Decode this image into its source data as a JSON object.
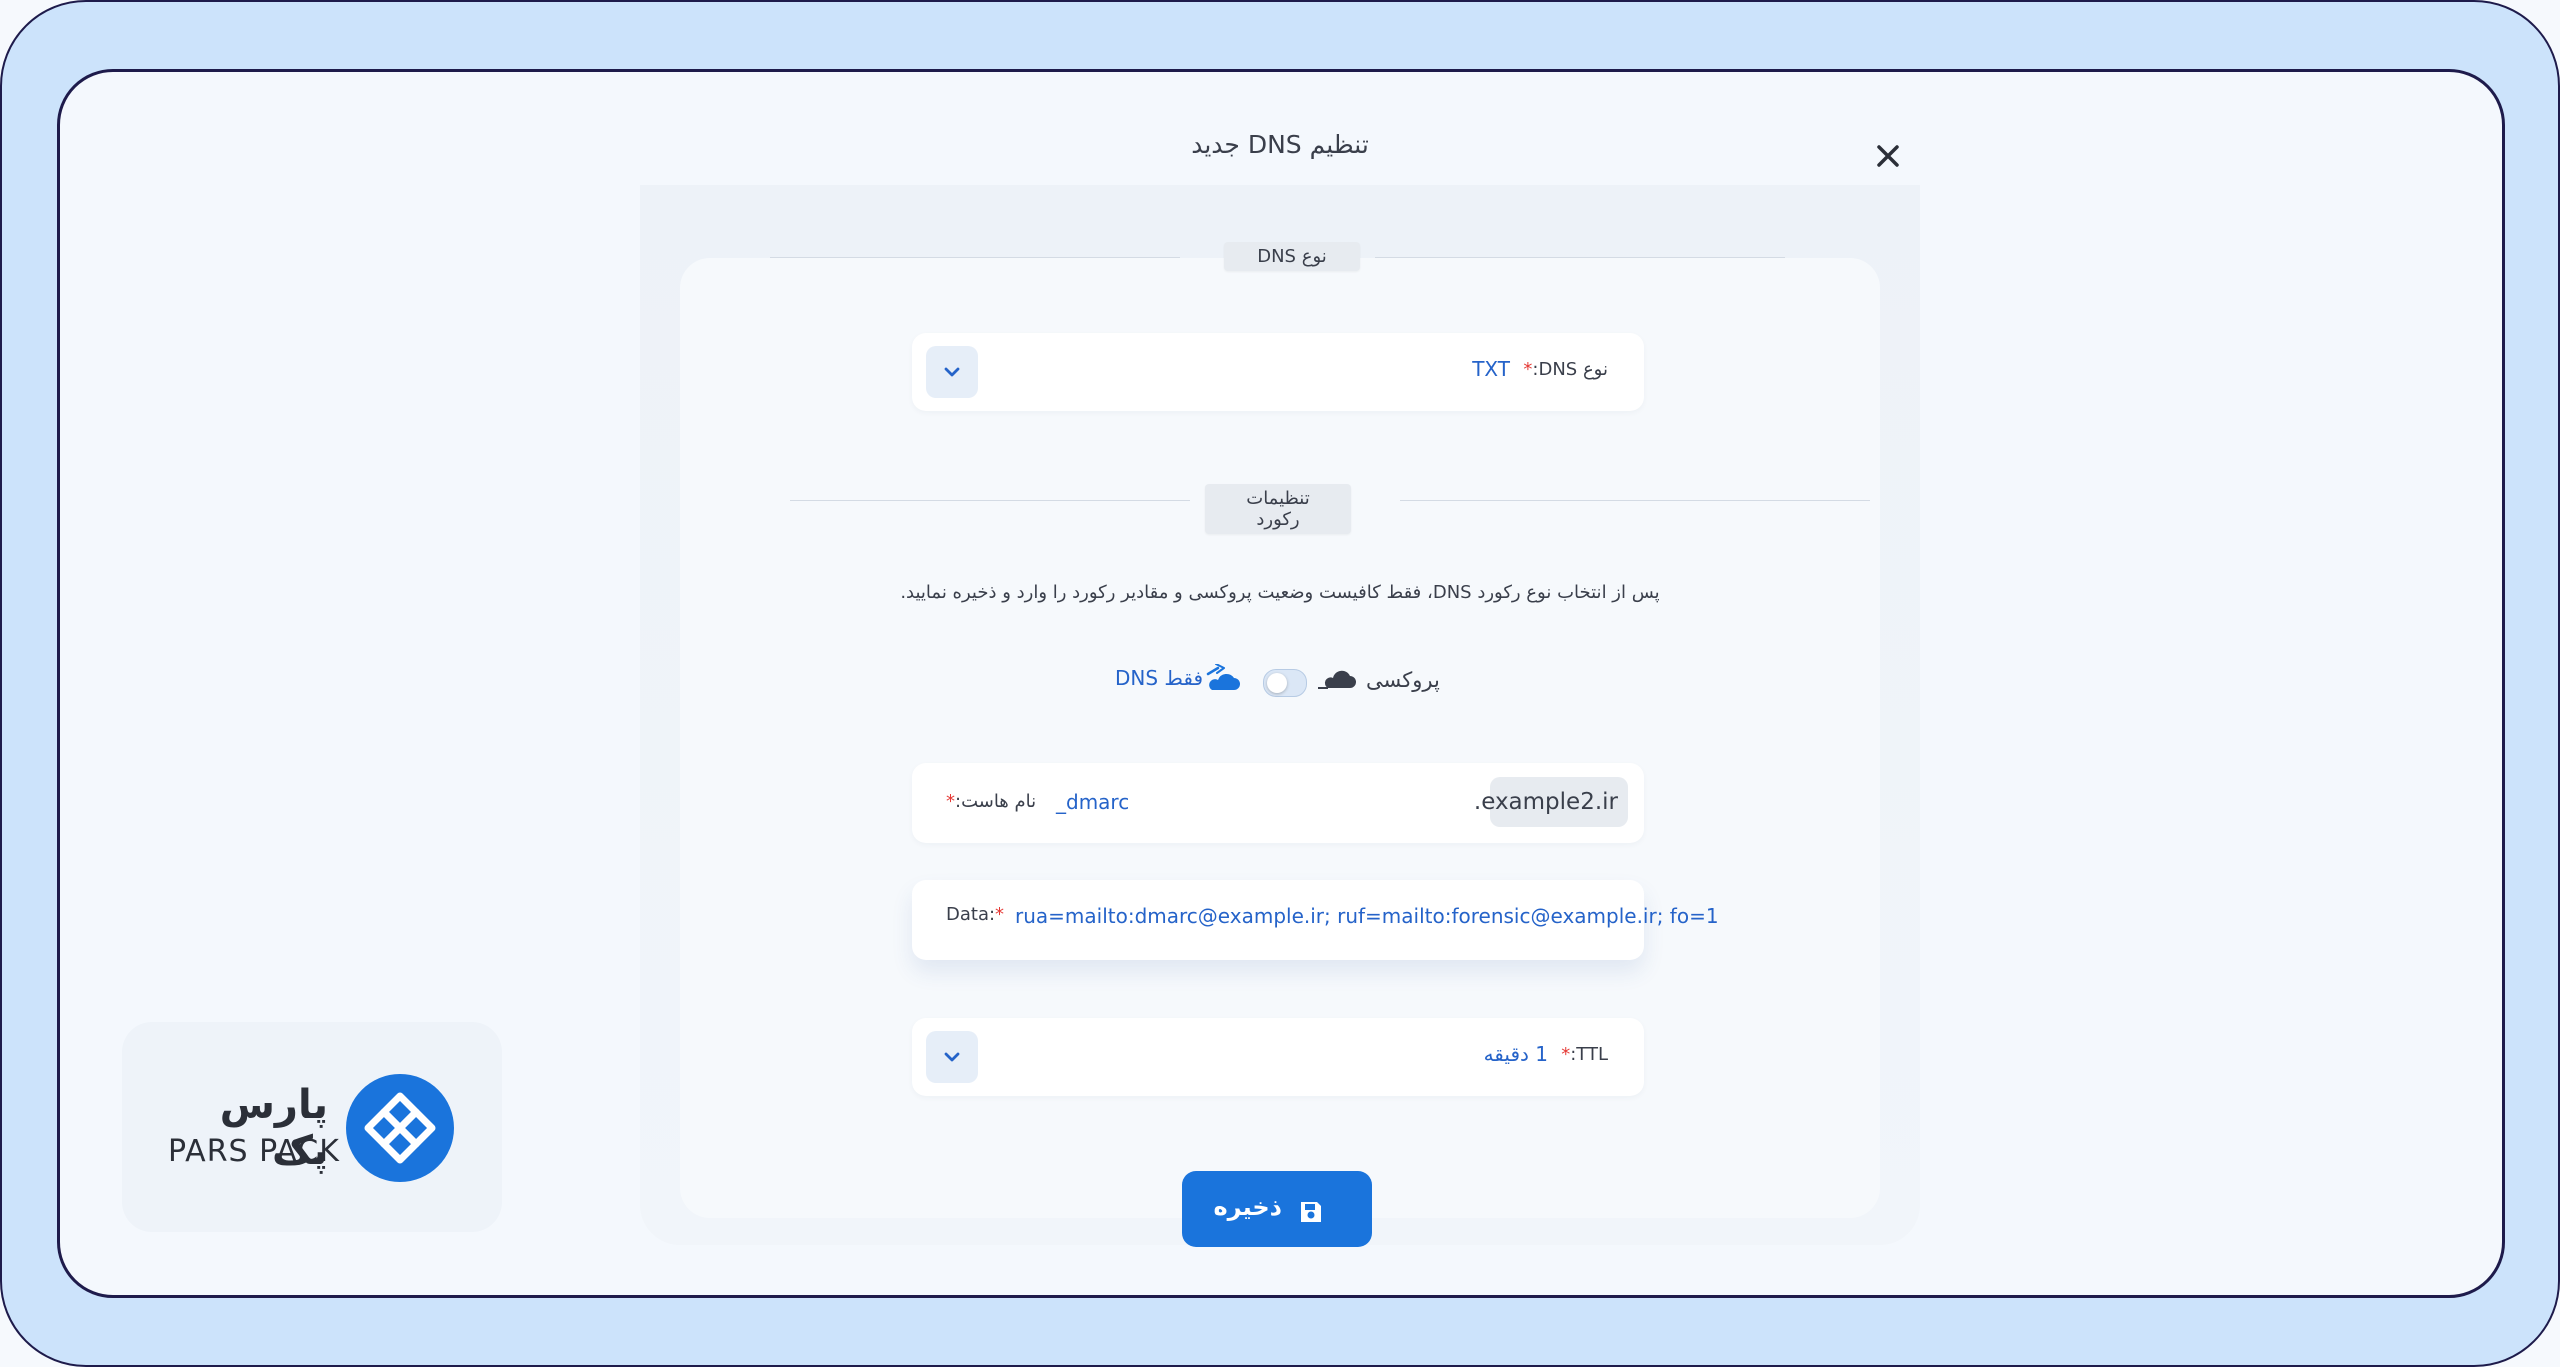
{
  "dialog": {
    "title": "تنظیم DNS جدید",
    "close_icon": "close-icon"
  },
  "dns_type_section": {
    "heading": "نوع DNS",
    "field_label": "نوع DNS:",
    "value": "TXT"
  },
  "record_section": {
    "heading": "تنظیمات رکورد",
    "help_text": "پس از انتخاب نوع رکورد DNS، فقط کافیست وضعیت پروکسی و مقادیر رکورد را وارد و ذخیره نمایید.",
    "proxy_label": "پروکسی",
    "dns_only_label": "فقط DNS",
    "proxy_enabled": false
  },
  "hostname": {
    "label": "نام هاست:",
    "value": "_dmarc",
    "suffix": ".example2.ir"
  },
  "data_field": {
    "label": "Data:",
    "value": "rua=mailto:dmarc@example.ir; ruf=mailto:forensic@example.ir; fo=1"
  },
  "ttl": {
    "label": "TTL:",
    "value": "1 دقیقه"
  },
  "save_button": {
    "label": "ذخیره"
  },
  "brand": {
    "name_fa": "پارس پک",
    "name_en": "PARS PACK",
    "color": "#1a74dc"
  },
  "colors": {
    "accent": "#1a74dc",
    "required": "#e53935",
    "frame": "#cce3fb"
  }
}
